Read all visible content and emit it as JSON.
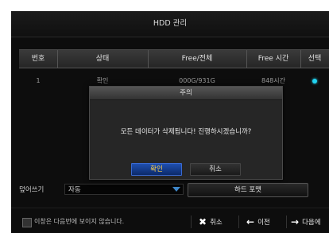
{
  "window": {
    "title": "HDD 관리"
  },
  "table": {
    "headers": [
      "번호",
      "상태",
      "Free/전체",
      "Free 시간",
      "선택"
    ],
    "rows": [
      {
        "no": "1",
        "status": "확인",
        "free_total": "000G/931G",
        "free_time": "848시간",
        "selected": true
      }
    ]
  },
  "overwrite": {
    "label": "덮어쓰기",
    "value": "자동"
  },
  "format_button": {
    "label": "하드 포맷"
  },
  "modal": {
    "title": "주의",
    "message": "모든 데이터가 삭제됩니다! 진행하시겠습니까?",
    "ok_label": "확인",
    "cancel_label": "취소"
  },
  "bottom": {
    "checkbox_label": "이창은 다음번에 보이지 않습니다.",
    "cancel_icon": "✖",
    "cancel_label": "취소",
    "prev_icon": "←",
    "prev_label": "이전",
    "next_icon": "→",
    "next_label": "다음에"
  },
  "colors": {
    "accent": "#22d3f0",
    "ok_text": "#ffd34a",
    "ok_button": "#1f4fb0",
    "dropdown_arrow": "#3e86c8"
  }
}
